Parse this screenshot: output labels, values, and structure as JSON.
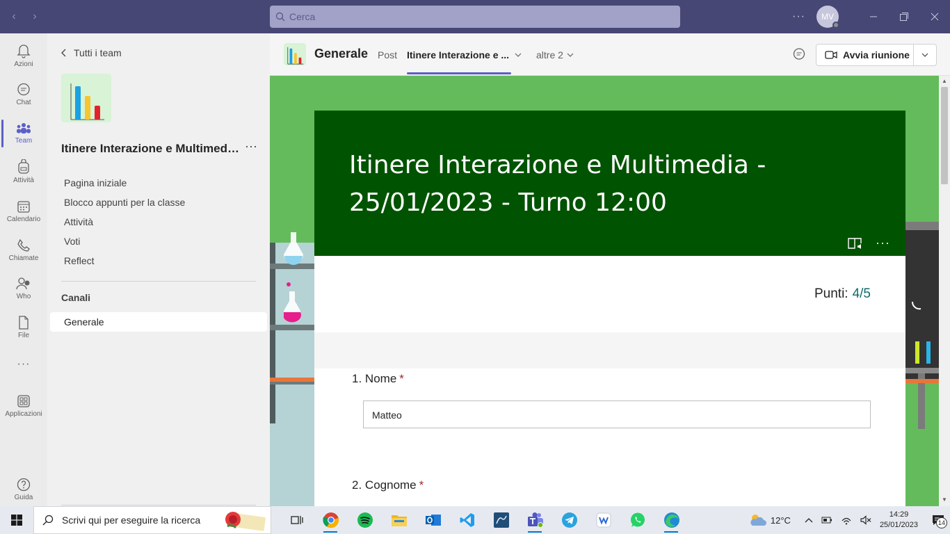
{
  "titlebar": {
    "search_placeholder": "Cerca",
    "avatar_initials": "MV",
    "more_label": "···"
  },
  "rail": {
    "items": [
      {
        "label": "Azioni",
        "icon": "bell-icon"
      },
      {
        "label": "Chat",
        "icon": "chat-icon"
      },
      {
        "label": "Team",
        "icon": "teams-icon"
      },
      {
        "label": "Attività",
        "icon": "backpack-icon"
      },
      {
        "label": "Calendario",
        "icon": "calendar-icon"
      },
      {
        "label": "Chiamate",
        "icon": "phone-icon"
      },
      {
        "label": "Who",
        "icon": "who-icon"
      },
      {
        "label": "File",
        "icon": "file-icon"
      },
      {
        "label": "",
        "icon": "more-icon"
      },
      {
        "label": "Applicazioni",
        "icon": "apps-icon"
      },
      {
        "label": "Guida",
        "icon": "help-icon"
      }
    ],
    "more_label": "···"
  },
  "panel": {
    "back_label": "Tutti i team",
    "team_name": "Itinere Interazione e Multimedia - 25/01/2023 - Turno 12:00",
    "team_more": "···",
    "links": [
      "Pagina iniziale",
      "Blocco appunti per la classe",
      "Attività",
      "Voti",
      "Reflect"
    ],
    "channels_heading": "Canali",
    "active_channel": "Generale"
  },
  "header": {
    "channel_name": "Generale",
    "tabs": [
      {
        "label": "Post"
      },
      {
        "label": "Itinere Interazione e ..."
      },
      {
        "label": "altre 2"
      }
    ],
    "meet_label": "Avvia riunione"
  },
  "form": {
    "title": "Itinere Interazione e Multimedia - 25/01/2023 - Turno 12:00",
    "score_label": "Punti:",
    "score_value": "4/5",
    "questions": [
      {
        "number": "1.",
        "label": "Nome",
        "required_mark": "*",
        "answer": "Matteo"
      },
      {
        "number": "2.",
        "label": "Cognome",
        "required_mark": "*"
      }
    ]
  },
  "taskbar": {
    "search_placeholder": "Scrivi qui per eseguire la ricerca",
    "apps": [
      "task-view-icon",
      "chrome-icon",
      "spotify-icon",
      "file-explorer-icon",
      "outlook-icon",
      "vscode-icon",
      "mysql-workbench-icon",
      "teams-icon",
      "telegram-icon",
      "app-icon",
      "whatsapp-icon",
      "edge-icon"
    ],
    "weather": "12°C",
    "time": "14:29",
    "date": "25/01/2023",
    "notification_count": "14"
  },
  "colors": {
    "titlebar": "#464775",
    "accent": "#5b5fc7",
    "form_banner": "#005300",
    "background_green": "#64bb5c",
    "score_value": "#0f6b6b",
    "required": "#a4262c"
  }
}
